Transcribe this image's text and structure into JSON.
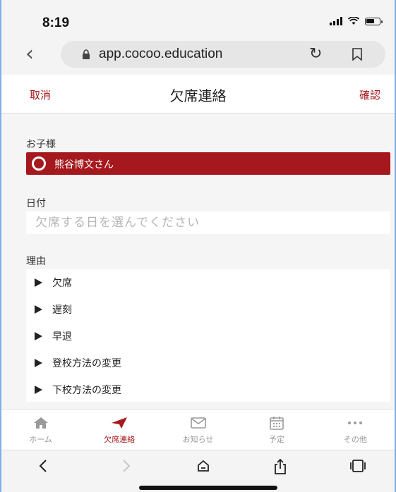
{
  "status_bar": {
    "time": "8:19"
  },
  "browser": {
    "url": "app.cocoo.education"
  },
  "header": {
    "cancel": "取消",
    "title": "欠席連絡",
    "confirm": "確認"
  },
  "form": {
    "child_label": "お子様",
    "child_name": "熊谷博文さん",
    "date_label": "日付",
    "date_placeholder": "欠席する日を選んでください",
    "reason_label": "理由",
    "reasons": [
      "欠席",
      "遅刻",
      "早退",
      "登校方法の変更",
      "下校方法の変更"
    ]
  },
  "tabs": [
    {
      "label": "ホーム",
      "icon": "home-icon"
    },
    {
      "label": "欠席連絡",
      "icon": "send-icon",
      "active": true
    },
    {
      "label": "お知らせ",
      "icon": "mail-icon"
    },
    {
      "label": "予定",
      "icon": "calendar-icon"
    },
    {
      "label": "その他",
      "icon": "more-icon"
    }
  ],
  "colors": {
    "accent": "#a5191e",
    "inactive": "#999999",
    "background": "#f5f5f5"
  }
}
